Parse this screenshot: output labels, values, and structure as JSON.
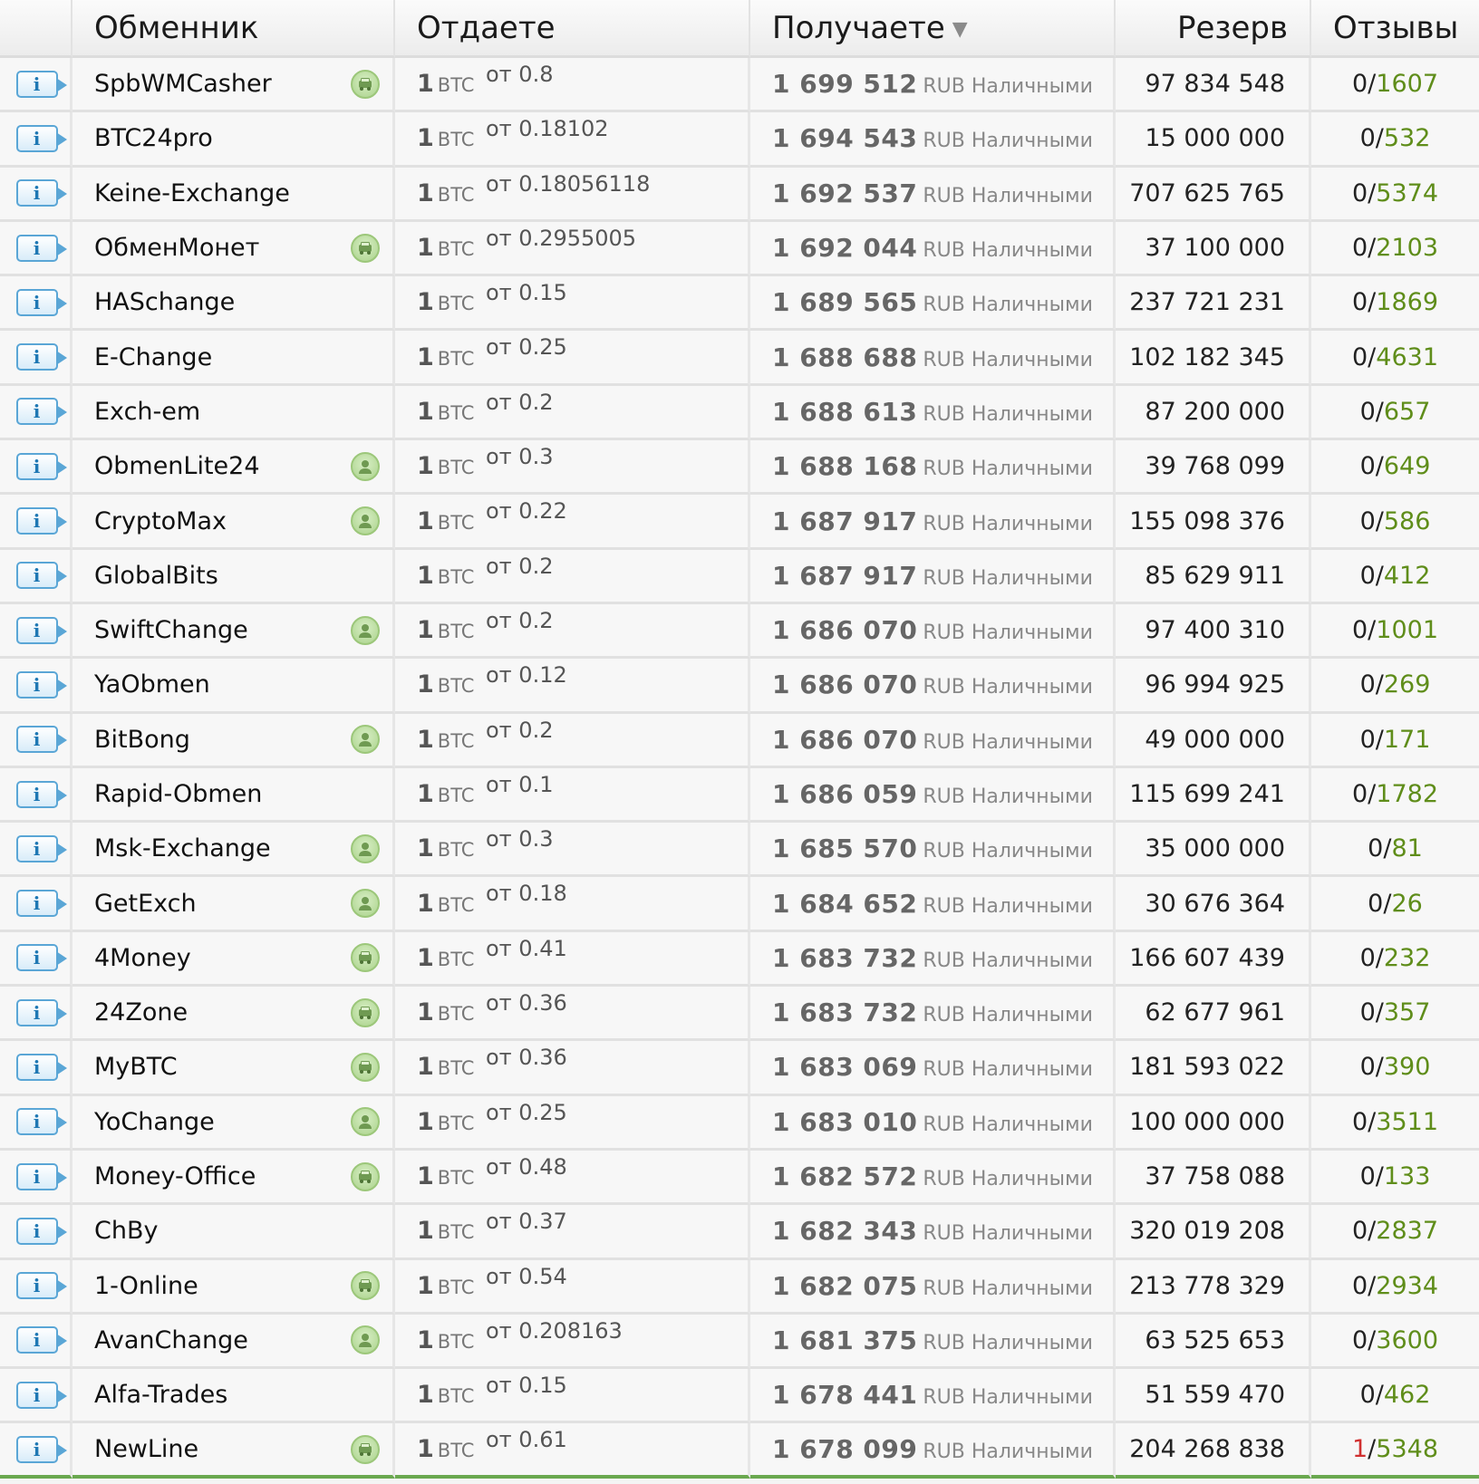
{
  "headers": {
    "exchanger": "Обменник",
    "give": "Отдаете",
    "get": "Получаете",
    "sort_arrow": "▼",
    "reserve": "Резерв",
    "reviews": "Отзывы"
  },
  "info_label": "i",
  "give_amount": "1",
  "give_currency": "BTC",
  "get_currency": "RUB Наличными",
  "review_separator": "/",
  "rows": [
    {
      "name": "SpbWMCasher",
      "badge": "car",
      "min": "от 0.8",
      "get": "1 699 512",
      "reserve": "97 834 548",
      "neg": "0",
      "pos": "1607"
    },
    {
      "name": "BTC24pro",
      "badge": "",
      "min": "от 0.18102",
      "get": "1 694 543",
      "reserve": "15 000 000",
      "neg": "0",
      "pos": "532"
    },
    {
      "name": "Keine-Exchange",
      "badge": "",
      "min": "от 0.18056118",
      "get": "1 692 537",
      "reserve": "707 625 765",
      "neg": "0",
      "pos": "5374"
    },
    {
      "name": "ОбменМонет",
      "badge": "car",
      "min": "от 0.2955005",
      "get": "1 692 044",
      "reserve": "37 100 000",
      "neg": "0",
      "pos": "2103"
    },
    {
      "name": "HASchange",
      "badge": "",
      "min": "от 0.15",
      "get": "1 689 565",
      "reserve": "237 721 231",
      "neg": "0",
      "pos": "1869"
    },
    {
      "name": "E-Change",
      "badge": "",
      "min": "от 0.25",
      "get": "1 688 688",
      "reserve": "102 182 345",
      "neg": "0",
      "pos": "4631"
    },
    {
      "name": "Exch-em",
      "badge": "",
      "min": "от 0.2",
      "get": "1 688 613",
      "reserve": "87 200 000",
      "neg": "0",
      "pos": "657"
    },
    {
      "name": "ObmenLite24",
      "badge": "person",
      "min": "от 0.3",
      "get": "1 688 168",
      "reserve": "39 768 099",
      "neg": "0",
      "pos": "649"
    },
    {
      "name": "CryptoMax",
      "badge": "person",
      "min": "от 0.22",
      "get": "1 687 917",
      "reserve": "155 098 376",
      "neg": "0",
      "pos": "586"
    },
    {
      "name": "GlobalBits",
      "badge": "",
      "min": "от 0.2",
      "get": "1 687 917",
      "reserve": "85 629 911",
      "neg": "0",
      "pos": "412"
    },
    {
      "name": "SwiftChange",
      "badge": "person",
      "min": "от 0.2",
      "get": "1 686 070",
      "reserve": "97 400 310",
      "neg": "0",
      "pos": "1001"
    },
    {
      "name": "YaObmen",
      "badge": "",
      "min": "от 0.12",
      "get": "1 686 070",
      "reserve": "96 994 925",
      "neg": "0",
      "pos": "269"
    },
    {
      "name": "BitBong",
      "badge": "person",
      "min": "от 0.2",
      "get": "1 686 070",
      "reserve": "49 000 000",
      "neg": "0",
      "pos": "171"
    },
    {
      "name": "Rapid-Obmen",
      "badge": "",
      "min": "от 0.1",
      "get": "1 686 059",
      "reserve": "115 699 241",
      "neg": "0",
      "pos": "1782"
    },
    {
      "name": "Msk-Exchange",
      "badge": "person",
      "min": "от 0.3",
      "get": "1 685 570",
      "reserve": "35 000 000",
      "neg": "0",
      "pos": "81"
    },
    {
      "name": "GetExch",
      "badge": "person",
      "min": "от 0.18",
      "get": "1 684 652",
      "reserve": "30 676 364",
      "neg": "0",
      "pos": "26"
    },
    {
      "name": "4Money",
      "badge": "car",
      "min": "от 0.41",
      "get": "1 683 732",
      "reserve": "166 607 439",
      "neg": "0",
      "pos": "232"
    },
    {
      "name": "24Zone",
      "badge": "car",
      "min": "от 0.36",
      "get": "1 683 732",
      "reserve": "62 677 961",
      "neg": "0",
      "pos": "357"
    },
    {
      "name": "MyBTC",
      "badge": "car",
      "min": "от 0.36",
      "get": "1 683 069",
      "reserve": "181 593 022",
      "neg": "0",
      "pos": "390"
    },
    {
      "name": "YoChange",
      "badge": "person",
      "min": "от 0.25",
      "get": "1 683 010",
      "reserve": "100 000 000",
      "neg": "0",
      "pos": "3511"
    },
    {
      "name": "Money-Office",
      "badge": "car",
      "min": "от 0.48",
      "get": "1 682 572",
      "reserve": "37 758 088",
      "neg": "0",
      "pos": "133"
    },
    {
      "name": "ChBy",
      "badge": "",
      "min": "от 0.37",
      "get": "1 682 343",
      "reserve": "320 019 208",
      "neg": "0",
      "pos": "2837"
    },
    {
      "name": "1-Online",
      "badge": "car",
      "min": "от 0.54",
      "get": "1 682 075",
      "reserve": "213 778 329",
      "neg": "0",
      "pos": "2934"
    },
    {
      "name": "AvanChange",
      "badge": "person",
      "min": "от 0.208163",
      "get": "1 681 375",
      "reserve": "63 525 653",
      "neg": "0",
      "pos": "3600"
    },
    {
      "name": "Alfa-Trades",
      "badge": "",
      "min": "от 0.15",
      "get": "1 678 441",
      "reserve": "51 559 470",
      "neg": "0",
      "pos": "462"
    },
    {
      "name": "NewLine",
      "badge": "car",
      "min": "от 0.61",
      "get": "1 678 099",
      "reserve": "204 268 838",
      "neg": "1",
      "pos": "5348"
    }
  ],
  "colors": {
    "positive": "#5f8d1a",
    "negative": "#d03030",
    "badge": "#a9d28a",
    "info": "#5aa6d6"
  }
}
